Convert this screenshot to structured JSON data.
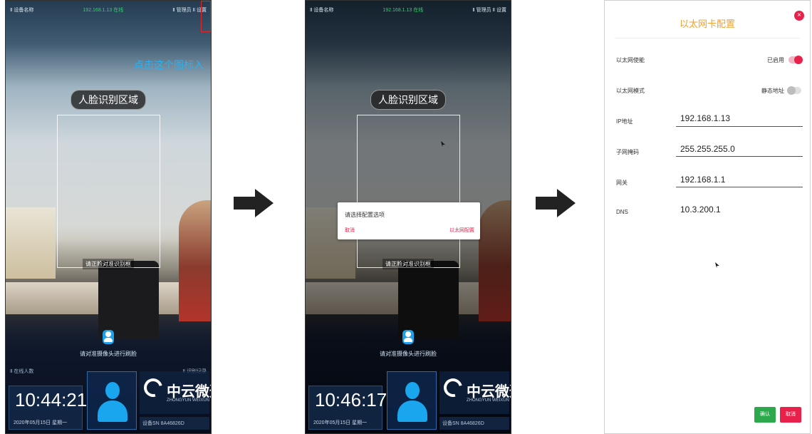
{
  "panel1": {
    "status_left": "Ⅱ 设备名称",
    "status_mid": "192.168.1.13  在线",
    "status_right": "Ⅱ 管理员 Ⅱ 设置",
    "tip": "点击这个图标入",
    "region_label": "人脸识别区域",
    "face_hint": "请正脸对准识别框",
    "mode_hint": "请对准摄像头进行刷脸",
    "bottom_left": "Ⅱ 在线人数",
    "bottom_right": "Ⅱ 识别记录",
    "time": "10:44:21",
    "date": "2020年05月15日 星期一",
    "logo_text": "中云微迅",
    "logo_sub": "ZHONGYUN WEIXUN",
    "sn": "设备SN 8A46826D"
  },
  "panel2": {
    "status_left": "Ⅱ 设备名称",
    "status_mid": "192.168.1.13  在线",
    "status_right": "Ⅱ 管理员 Ⅱ 设置",
    "region_label": "人脸识别区域",
    "face_hint": "请正脸对准识别框",
    "mode_hint": "请对准摄像头进行刷脸",
    "time": "10:46:17",
    "date": "2020年05月15日 星期一",
    "logo_text": "中云微迅",
    "logo_sub": "ZHONGYUN WEIXUN",
    "sn": "设备SN 8A46826D",
    "dialog": {
      "title": "请选择配置选项",
      "cancel": "取消",
      "confirm": "以太网配置"
    }
  },
  "panel3": {
    "title": "以太网卡配置",
    "close": "×",
    "rows": [
      {
        "label": "以太网使能",
        "toggle_text": "已启用",
        "on": true
      },
      {
        "label": "以太网模式",
        "toggle_text": "静态地址",
        "on": false
      }
    ],
    "fields": [
      {
        "label": "IP地址",
        "value": "192.168.1.13",
        "underline": true
      },
      {
        "label": "子网掩码",
        "value": "255.255.255.0",
        "underline": true
      },
      {
        "label": "网关",
        "value": "192.168.1.1",
        "underline": true
      },
      {
        "label": "DNS",
        "value": "10.3.200.1",
        "underline": false
      }
    ],
    "ok": "确认",
    "cancel": "取消"
  }
}
